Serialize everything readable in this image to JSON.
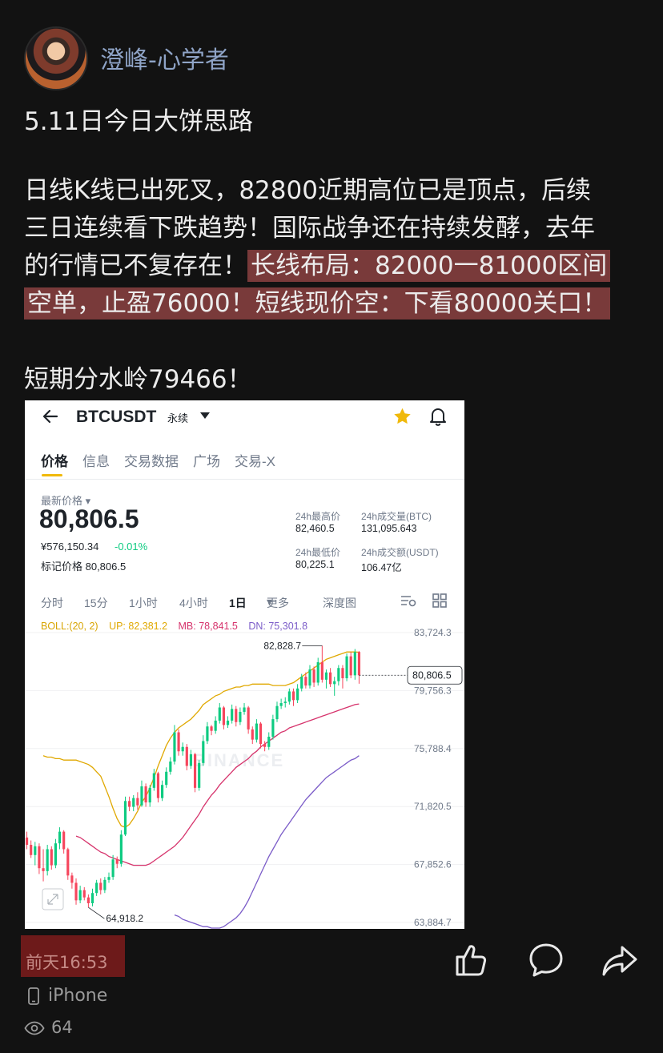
{
  "post": {
    "username": "澄峰-心学者",
    "title": "5.11日今日大饼思路",
    "body_line1": "日线K线已出死叉，82800近期高位已是顶点，后续",
    "body_line2": "三日连续看下跌趋势！国际战争还在持续发酵，去年",
    "body_line3_plain": "的行情已不复存在！",
    "body_line3_hl": "长线布局：82000一81000区间",
    "body_line4_hl": "空单，止盈76000！短线现价空：下看80000关口！",
    "watershed": "短期分水岭79466！",
    "time": "前天16:53",
    "device": "iPhone",
    "views": "64",
    "icons": [
      "avatar",
      "like-icon",
      "comment-icon",
      "share-icon",
      "phone-icon",
      "eye-icon"
    ],
    "highlight_color": "#8c4242"
  },
  "screenshot": {
    "pair": "BTCUSDT",
    "contract": "永续",
    "tabs": [
      "价格",
      "信息",
      "交易数据",
      "广场",
      "交易-X"
    ],
    "latest_price_label": "最新价格",
    "latest_price": "80,806.5",
    "cny_price": "¥576,150.34",
    "change": "-0.01%",
    "mark_price": "标记价格 80,806.5",
    "stats": {
      "high_label": "24h最高价",
      "high": "82,460.5",
      "vol_btc_label": "24h成交量(BTC)",
      "vol_btc": "131,095.643",
      "low_label": "24h最低价",
      "low": "80,225.1",
      "vol_usdt_label": "24h成交额(USDT)",
      "vol_usdt": "106.47亿"
    },
    "intervals": [
      "分时",
      "15分",
      "1小时",
      "4小时",
      "1日",
      "更多",
      "深度图"
    ],
    "active_interval": "1日",
    "boll": {
      "label": "BOLL:(20, 2)",
      "up": "UP: 82,381.2",
      "mb": "MB: 78,841.5",
      "dn": "DN: 75,301.8",
      "colors": {
        "label": "#d8a400",
        "up": "#e0a800",
        "mb": "#d6336c",
        "dn": "#7b5cc8"
      }
    },
    "watermark": "BINANCE",
    "colors": {
      "up": "#0ecb81",
      "down": "#f6465d",
      "accent": "#f0b90b"
    }
  },
  "chart_data": {
    "type": "candlestick",
    "y_ticks": [
      83724.3,
      79756.3,
      75788.4,
      71820.5,
      67852.6,
      63884.7
    ],
    "y_tick_labels": [
      "83,724.3",
      "79,756.3",
      "75,788.4",
      "71,820.5",
      "67,852.6",
      "63,884.7"
    ],
    "ylim": [
      63884.7,
      83724.3
    ],
    "current_price": 80806.5,
    "current_price_label": "80,806.5",
    "max_annotation": {
      "value": 82828.7,
      "label": "82,828.7",
      "index": 72
    },
    "min_annotation": {
      "value": 64918.2,
      "label": "64,918.2",
      "index": 15
    },
    "candles": [
      [
        69700,
        69200,
        70100,
        68900
      ],
      [
        69200,
        68500,
        69500,
        68300
      ],
      [
        68500,
        69100,
        69400,
        67800
      ],
      [
        69100,
        67600,
        69300,
        67200
      ],
      [
        67600,
        67400,
        68900,
        66700
      ],
      [
        67400,
        68900,
        69200,
        67100
      ],
      [
        68900,
        67800,
        69100,
        67500
      ],
      [
        67800,
        69300,
        69600,
        67600
      ],
      [
        69300,
        70100,
        70400,
        68900
      ],
      [
        70100,
        68900,
        70200,
        68600
      ],
      [
        68900,
        67100,
        69000,
        66800
      ],
      [
        67100,
        66600,
        67300,
        66200
      ],
      [
        66600,
        65400,
        66900,
        65100
      ],
      [
        65400,
        66100,
        66400,
        65200
      ],
      [
        66100,
        65600,
        66300,
        65400
      ],
      [
        65600,
        65200,
        65800,
        64918.2
      ],
      [
        65200,
        65900,
        66200,
        64990
      ],
      [
        65900,
        66600,
        66800,
        65700
      ],
      [
        66600,
        66100,
        66900,
        65800
      ],
      [
        66100,
        66800,
        67000,
        65900
      ],
      [
        66800,
        67000,
        67300,
        66600
      ],
      [
        67000,
        68200,
        68500,
        66800
      ],
      [
        68200,
        67900,
        68400,
        67600
      ],
      [
        67900,
        69900,
        70200,
        67700
      ],
      [
        69900,
        72200,
        72500,
        69800
      ],
      [
        72200,
        71800,
        72500,
        71500
      ],
      [
        71800,
        72400,
        72600,
        71500
      ],
      [
        72400,
        71900,
        72800,
        71600
      ],
      [
        71900,
        73200,
        73600,
        71800
      ],
      [
        73200,
        72100,
        73400,
        71800
      ],
      [
        72100,
        73100,
        73300,
        71800
      ],
      [
        73100,
        74100,
        74400,
        72900
      ],
      [
        74100,
        72400,
        74200,
        72100
      ],
      [
        72400,
        73300,
        73600,
        72200
      ],
      [
        73300,
        74200,
        74500,
        73100
      ],
      [
        74200,
        74900,
        75200,
        74000
      ],
      [
        74900,
        76900,
        77400,
        74700
      ],
      [
        76900,
        75600,
        77100,
        75300
      ],
      [
        75600,
        75900,
        76200,
        75300
      ],
      [
        75900,
        74600,
        76100,
        74300
      ],
      [
        74600,
        75400,
        75700,
        74400
      ],
      [
        75400,
        73100,
        75500,
        72800
      ],
      [
        73100,
        74800,
        75000,
        72900
      ],
      [
        74800,
        76300,
        76700,
        74600
      ],
      [
        76300,
        77300,
        77600,
        76100
      ],
      [
        77300,
        77000,
        77400,
        76700
      ],
      [
        77000,
        77700,
        78000,
        76800
      ],
      [
        77700,
        78600,
        78900,
        77500
      ],
      [
        78600,
        77400,
        78700,
        77100
      ],
      [
        77400,
        77700,
        78000,
        77200
      ],
      [
        77700,
        78500,
        78800,
        77500
      ],
      [
        78500,
        77600,
        78700,
        77300
      ],
      [
        77600,
        78300,
        78600,
        77400
      ],
      [
        78300,
        78600,
        78900,
        78100
      ],
      [
        78600,
        77100,
        78700,
        76800
      ],
      [
        77100,
        76400,
        77300,
        76100
      ],
      [
        76400,
        77500,
        77800,
        76200
      ],
      [
        77500,
        76100,
        77600,
        75800
      ],
      [
        76100,
        75900,
        76300,
        75600
      ],
      [
        75900,
        76600,
        76900,
        75700
      ],
      [
        76600,
        77800,
        78100,
        76400
      ],
      [
        77800,
        78700,
        79000,
        77600
      ],
      [
        78700,
        78900,
        79200,
        78500
      ],
      [
        78900,
        79000,
        79300,
        78600
      ],
      [
        79000,
        79700,
        79900,
        78800
      ],
      [
        79700,
        79100,
        79900,
        78700
      ],
      [
        79100,
        79900,
        80200,
        78900
      ],
      [
        79900,
        80700,
        80900,
        79700
      ],
      [
        80700,
        80100,
        81000,
        79900
      ],
      [
        80100,
        81200,
        81500,
        79900
      ],
      [
        81200,
        80300,
        81400,
        80000
      ],
      [
        80300,
        81700,
        82000,
        80100
      ],
      [
        81700,
        80500,
        82828.7,
        80300
      ],
      [
        80500,
        81000,
        81200,
        79900
      ],
      [
        81000,
        80200,
        81300,
        80000
      ],
      [
        80200,
        80400,
        80700,
        79400
      ],
      [
        80400,
        81300,
        81500,
        80100
      ],
      [
        81300,
        80600,
        81500,
        79900
      ],
      [
        80600,
        82100,
        82300,
        80400
      ],
      [
        82100,
        80800,
        82400,
        80600
      ],
      [
        80800,
        82400,
        82600,
        80500
      ],
      [
        82400,
        80806.5,
        82460.5,
        80225.1
      ]
    ],
    "boll_up": [
      75300,
      75200,
      75200,
      75100,
      75100,
      75000,
      75000,
      75000,
      75000,
      74900,
      74800,
      74700,
      74500,
      74200,
      73900,
      73200,
      72500,
      71700,
      71000,
      70500,
      70400,
      70600,
      71000,
      71500,
      72100,
      72500,
      73100,
      73800,
      74600,
      75300,
      76000,
      76500,
      76900,
      77200,
      77400,
      77600,
      77800,
      78100,
      78400,
      78800,
      79000,
      79200,
      79400,
      79500,
      79700,
      79800,
      79900,
      80000,
      80000,
      80100,
      80100,
      80200,
      80200,
      80200,
      80200,
      80200,
      80100,
      80100,
      80100,
      80100,
      80200,
      80300,
      80500,
      80700,
      80900,
      81100,
      81300,
      81500,
      81700,
      81900,
      82000,
      82100,
      82200,
      82300,
      82400,
      82400,
      82400,
      82381.2
    ],
    "boll_mid": [
      69800,
      69700,
      69500,
      69300,
      69100,
      68900,
      68700,
      68600,
      68400,
      68300,
      68200,
      68100,
      68000,
      67900,
      67800,
      67800,
      67800,
      67800,
      67900,
      68100,
      68300,
      68500,
      68700,
      68900,
      69100,
      69400,
      69700,
      70100,
      70500,
      70900,
      71300,
      71800,
      72200,
      72600,
      72900,
      73300,
      73600,
      73900,
      74200,
      74500,
      74700,
      74900,
      75100,
      75400,
      75600,
      75900,
      76100,
      76300,
      76500,
      76700,
      76900,
      77000,
      77200,
      77300,
      77400,
      77500,
      77600,
      77700,
      77800,
      77900,
      78000,
      78100,
      78200,
      78300,
      78400,
      78500,
      78600,
      78700,
      78800,
      78841.5
    ],
    "boll_dn": [
      64400,
      64300,
      64100,
      64000,
      63900,
      63800,
      63700,
      63600,
      63600,
      63500,
      63500,
      63500,
      63600,
      63800,
      64000,
      64200,
      64500,
      64900,
      65400,
      66000,
      66600,
      67200,
      67800,
      68400,
      68900,
      69400,
      69900,
      70300,
      70700,
      71100,
      71500,
      71900,
      72300,
      72600,
      72900,
      73200,
      73500,
      73800,
      74000,
      74200,
      74400,
      74600,
      74800,
      75000,
      75100,
      75301.8
    ]
  }
}
